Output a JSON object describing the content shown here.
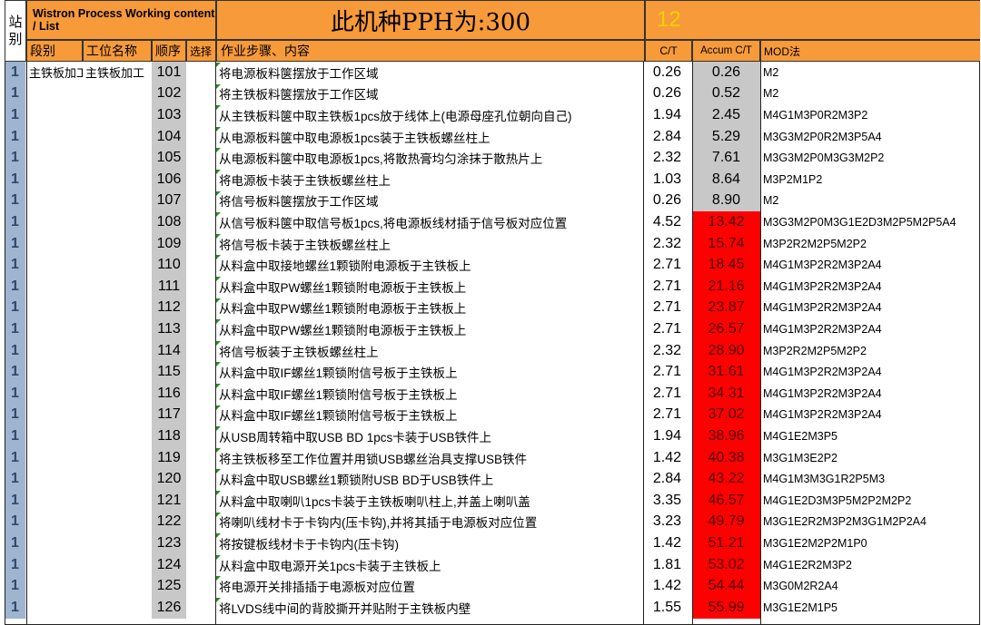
{
  "header": {
    "station_label": "站\n别",
    "process_title": "Wistron Process Working content / List",
    "pph_text": "此机种PPH为:300",
    "station_count": "12"
  },
  "columns": {
    "segment": "段别",
    "station_name": "工位名称",
    "sequence": "顺序",
    "select": "选择",
    "steps": "作业步骤、内容",
    "ct": "C/T",
    "accum_ct": "Accum C/T",
    "mod": "MOD法"
  },
  "colors": {
    "orange": "#f79a3a",
    "station_blue": "#9fb5cf",
    "grey": "#c8c8c8",
    "red": "#ff0000",
    "yellow_text": "#f2d100"
  },
  "rows": [
    {
      "station": "1",
      "segment": "主铁板加工",
      "station_name": "主铁板加工",
      "seq": "101",
      "step": "将电源板料箧摆放于工作区域",
      "ct": "0.26",
      "accum": "0.26",
      "accum_color": "grey",
      "mod": "M2"
    },
    {
      "station": "1",
      "segment": "",
      "station_name": "",
      "seq": "102",
      "step": "将主铁板料箧摆放于工作区域",
      "ct": "0.26",
      "accum": "0.52",
      "accum_color": "grey",
      "mod": "M2"
    },
    {
      "station": "1",
      "segment": "",
      "station_name": "",
      "seq": "103",
      "step": "从主铁板料箧中取主铁板1pcs放于线体上(电源母座孔位朝向自己)",
      "ct": "1.94",
      "accum": "2.45",
      "accum_color": "grey",
      "mod": "M4G1M3P0R2M3P2"
    },
    {
      "station": "1",
      "segment": "",
      "station_name": "",
      "seq": "104",
      "step": "从电源板料箧中取电源板1pcs装于主铁板螺丝柱上",
      "ct": "2.84",
      "accum": "5.29",
      "accum_color": "grey",
      "mod": "M3G3M2P0R2M3P5A4"
    },
    {
      "station": "1",
      "segment": "",
      "station_name": "",
      "seq": "105",
      "step": "从电源板料箧中取电源板1pcs,将散热膏均匀涂抹于散热片上",
      "ct": "2.32",
      "accum": "7.61",
      "accum_color": "grey",
      "mod": "M3G3M2P0M3G3M2P2"
    },
    {
      "station": "1",
      "segment": "",
      "station_name": "",
      "seq": "106",
      "step": "将电源板卡装于主铁板螺丝柱上",
      "ct": "1.03",
      "accum": "8.64",
      "accum_color": "grey",
      "mod": "M3P2M1P2"
    },
    {
      "station": "1",
      "segment": "",
      "station_name": "",
      "seq": "107",
      "step": "将信号板料箧摆放于工作区域",
      "ct": "0.26",
      "accum": "8.90",
      "accum_color": "grey",
      "mod": "M2"
    },
    {
      "station": "1",
      "segment": "",
      "station_name": "",
      "seq": "108",
      "step": "从信号板料箧中取信号板1pcs,将电源板线材插于信号板对应位置",
      "ct": "4.52",
      "accum": "13.42",
      "accum_color": "red",
      "mod": "M3G3M2P0M3G1E2D3M2P5M2P5A4"
    },
    {
      "station": "1",
      "segment": "",
      "station_name": "",
      "seq": "109",
      "step": "将信号板卡装于主铁板螺丝柱上",
      "ct": "2.32",
      "accum": "15.74",
      "accum_color": "red",
      "mod": "M3P2R2M2P5M2P2"
    },
    {
      "station": "1",
      "segment": "",
      "station_name": "",
      "seq": "110",
      "step": "从料盒中取接地螺丝1颗锁附电源板于主铁板上",
      "ct": "2.71",
      "accum": "18.45",
      "accum_color": "red",
      "mod": "M4G1M3P2R2M3P2A4"
    },
    {
      "station": "1",
      "segment": "",
      "station_name": "",
      "seq": "111",
      "step": "从料盒中取PW螺丝1颗锁附电源板于主铁板上",
      "ct": "2.71",
      "accum": "21.16",
      "accum_color": "red",
      "mod": "M4G1M3P2R2M3P2A4"
    },
    {
      "station": "1",
      "segment": "",
      "station_name": "",
      "seq": "112",
      "step": "从料盒中取PW螺丝1颗锁附电源板于主铁板上",
      "ct": "2.71",
      "accum": "23.87",
      "accum_color": "red",
      "mod": "M4G1M3P2R2M3P2A4"
    },
    {
      "station": "1",
      "segment": "",
      "station_name": "",
      "seq": "113",
      "step": "从料盒中取PW螺丝1颗锁附电源板于主铁板上",
      "ct": "2.71",
      "accum": "26.57",
      "accum_color": "red",
      "mod": "M4G1M3P2R2M3P2A4"
    },
    {
      "station": "1",
      "segment": "",
      "station_name": "",
      "seq": "114",
      "step": "将信号板装于主铁板螺丝柱上",
      "ct": "2.32",
      "accum": "28.90",
      "accum_color": "red",
      "mod": "M3P2R2M2P5M2P2"
    },
    {
      "station": "1",
      "segment": "",
      "station_name": "",
      "seq": "115",
      "step": "从料盒中取IF螺丝1颗锁附信号板于主铁板上",
      "ct": "2.71",
      "accum": "31.61",
      "accum_color": "red",
      "mod": "M4G1M3P2R2M3P2A4"
    },
    {
      "station": "1",
      "segment": "",
      "station_name": "",
      "seq": "116",
      "step": "从料盒中取IF螺丝1颗锁附信号板于主铁板上",
      "ct": "2.71",
      "accum": "34.31",
      "accum_color": "red",
      "mod": "M4G1M3P2R2M3P2A4"
    },
    {
      "station": "1",
      "segment": "",
      "station_name": "",
      "seq": "117",
      "step": "从料盒中取IF螺丝1颗锁附信号板于主铁板上",
      "ct": "2.71",
      "accum": "37.02",
      "accum_color": "red",
      "mod": "M4G1M3P2R2M3P2A4"
    },
    {
      "station": "1",
      "segment": "",
      "station_name": "",
      "seq": "118",
      "step": "从USB周转箱中取USB BD 1pcs卡装于USB铁件上",
      "ct": "1.94",
      "accum": "38.96",
      "accum_color": "red",
      "mod": "M4G1E2M3P5"
    },
    {
      "station": "1",
      "segment": "",
      "station_name": "",
      "seq": "119",
      "step": "将主铁板移至工作位置并用锁USB螺丝治具支撑USB铁件",
      "ct": "1.42",
      "accum": "40.38",
      "accum_color": "red",
      "mod": "M3G1M3E2P2"
    },
    {
      "station": "1",
      "segment": "",
      "station_name": "",
      "seq": "120",
      "step": "从料盒中取USB螺丝1颗锁附USB BD于USB铁件上",
      "ct": "2.84",
      "accum": "43.22",
      "accum_color": "red",
      "mod": "M4G1M3M3G1R2P5M3"
    },
    {
      "station": "1",
      "segment": "",
      "station_name": "",
      "seq": "121",
      "step": "从料盒中取喇叭1pcs卡装于主铁板喇叭柱上,并盖上喇叭盖",
      "ct": "3.35",
      "accum": "46.57",
      "accum_color": "red",
      "mod": "M4G1E2D3M3P5M2P2M2P2"
    },
    {
      "station": "1",
      "segment": "",
      "station_name": "",
      "seq": "122",
      "step": "将喇叭线材卡于卡钩内(压卡钩),并将其插于电源板对应位置",
      "ct": "3.23",
      "accum": "49.79",
      "accum_color": "red",
      "mod": "M3G1E2R2M3P2M3G1M2P2A4"
    },
    {
      "station": "1",
      "segment": "",
      "station_name": "",
      "seq": "123",
      "step": "将按键板线材卡于卡钩内(压卡钩)",
      "ct": "1.42",
      "accum": "51.21",
      "accum_color": "red",
      "mod": "M3G1E2M2P2M1P0"
    },
    {
      "station": "1",
      "segment": "",
      "station_name": "",
      "seq": "124",
      "step": "从料盒中取电源开关1pcs卡装于主铁板上",
      "ct": "1.81",
      "accum": "53.02",
      "accum_color": "red",
      "mod": "M4G1E2R2M3P2"
    },
    {
      "station": "1",
      "segment": "",
      "station_name": "",
      "seq": "125",
      "step": "将电源开关排插插于电源板对应位置",
      "ct": "1.42",
      "accum": "54.44",
      "accum_color": "red",
      "mod": "M3G0M2R2A4"
    },
    {
      "station": "1",
      "segment": "",
      "station_name": "",
      "seq": "126",
      "step": "将LVDS线中间的背胶撕开并贴附于主铁板内壁",
      "ct": "1.55",
      "accum": "55.99",
      "accum_color": "red",
      "mod": "M3G1E2M1P5"
    }
  ]
}
